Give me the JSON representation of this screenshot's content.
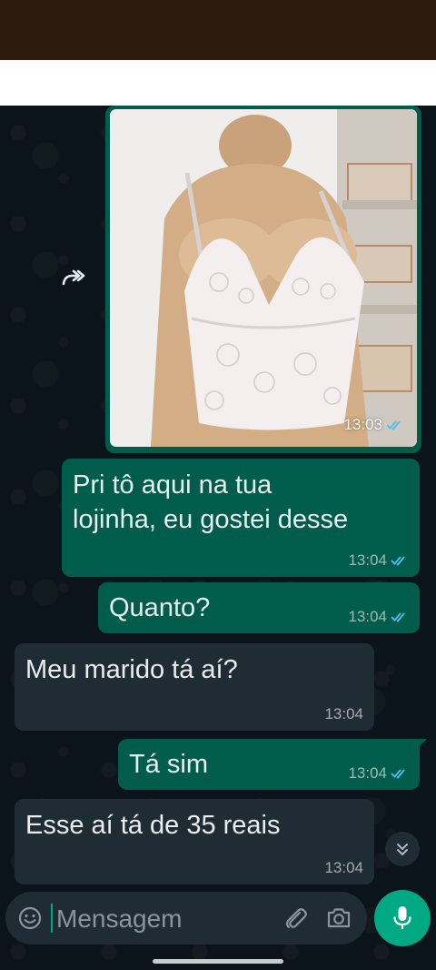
{
  "messages": [
    {
      "id": "m1",
      "type": "image",
      "direction": "out",
      "time": "13:03",
      "status": "read"
    },
    {
      "id": "m2",
      "type": "text",
      "direction": "out",
      "lines": [
        "Pri tô aqui na tua",
        "lojinha, eu gostei desse"
      ],
      "time": "13:04",
      "status": "read"
    },
    {
      "id": "m3",
      "type": "text",
      "direction": "out",
      "text": "Quanto?",
      "time": "13:04",
      "status": "read"
    },
    {
      "id": "m4",
      "type": "text",
      "direction": "in",
      "text": "Meu marido tá aí?",
      "time": "13:04"
    },
    {
      "id": "m5",
      "type": "text",
      "direction": "out",
      "text": "Tá sim",
      "time": "13:04",
      "status": "read"
    },
    {
      "id": "m6",
      "type": "text",
      "direction": "in",
      "text": "Esse aí tá de 35 reais",
      "time": "13:04"
    }
  ],
  "composer": {
    "placeholder": "Mensagem"
  },
  "icons": {
    "forward": "forward-icon",
    "read": "double-check-icon",
    "scroll": "chevrons-down-icon",
    "emoji": "emoji-icon",
    "attach": "paperclip-icon",
    "camera": "camera-icon",
    "mic": "microphone-icon"
  },
  "colors": {
    "outgoing_bubble": "#005c4b",
    "incoming_bubble": "#202c33",
    "background": "#0b141a",
    "accent": "#00a884",
    "read_tick": "#53bdeb",
    "text": "#e9edef"
  }
}
